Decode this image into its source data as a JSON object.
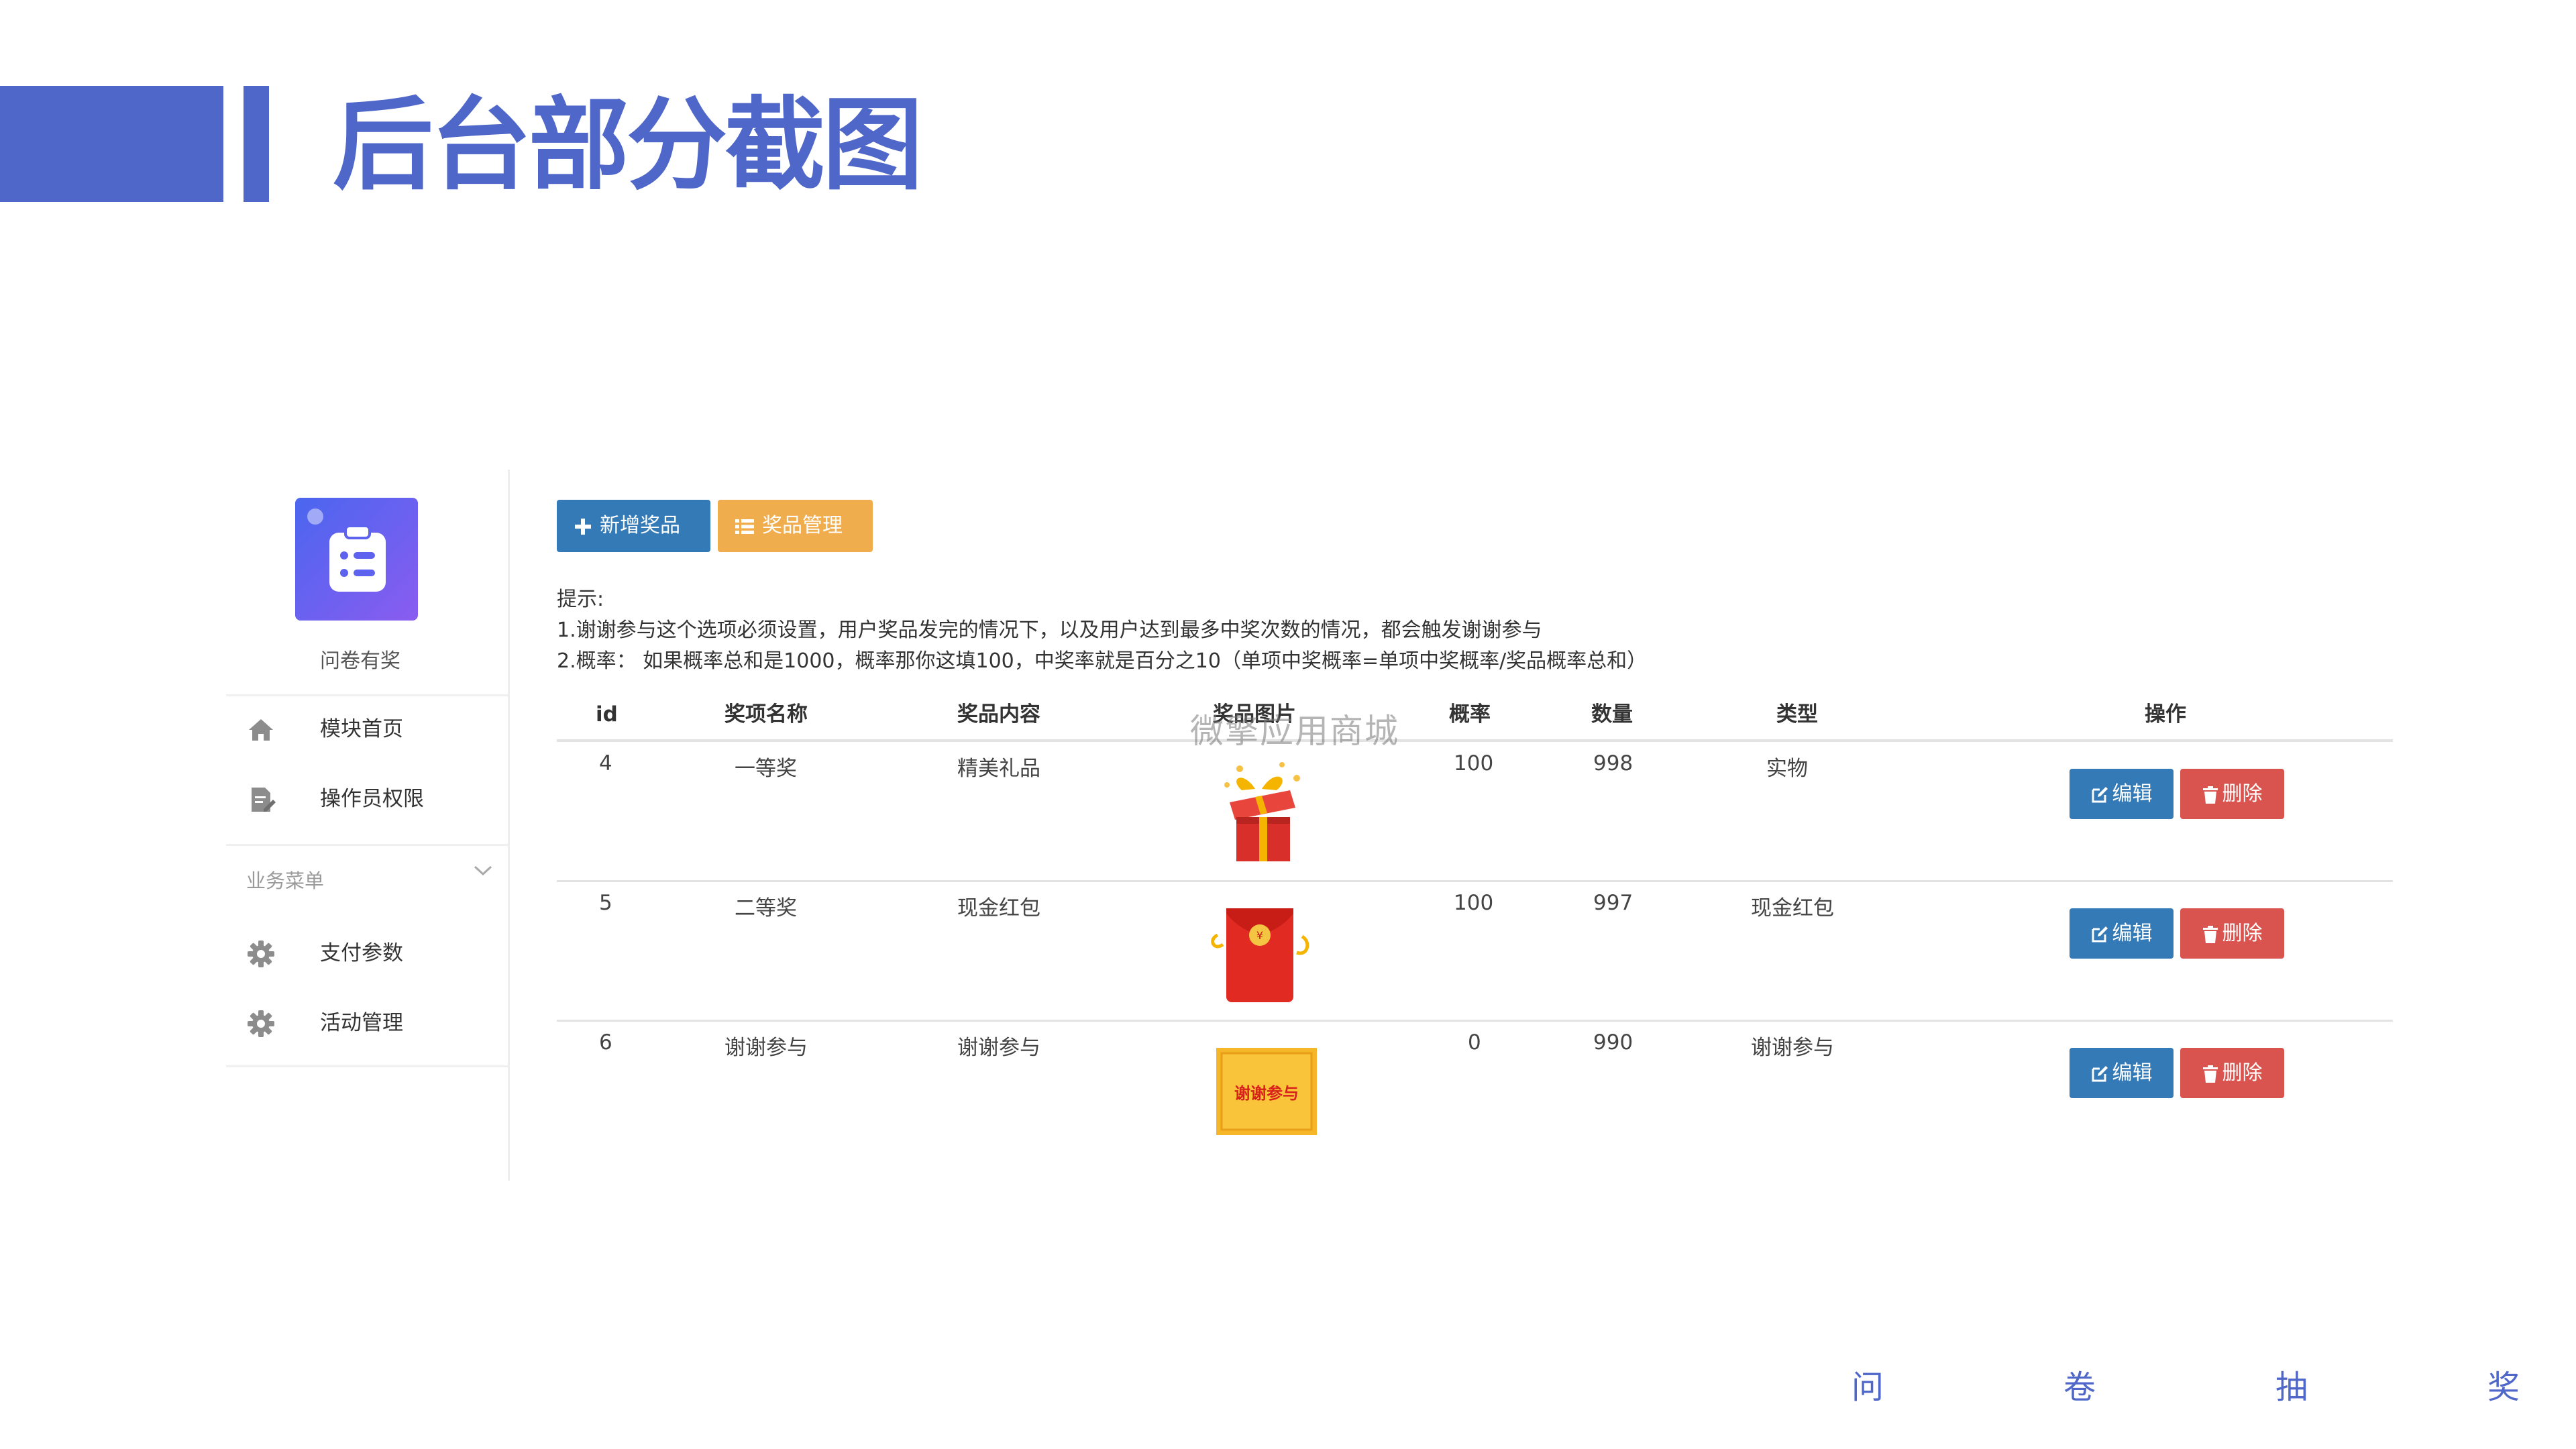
{
  "slide": {
    "title": "后台部分截图",
    "footer": [
      "问",
      "卷",
      "抽",
      "奖"
    ],
    "accent": "#4f67c9"
  },
  "sidebar": {
    "app_name": "问卷有奖",
    "items": [
      {
        "label": "模块首页",
        "icon": "home-icon"
      },
      {
        "label": "操作员权限",
        "icon": "document-edit-icon"
      }
    ],
    "group_label": "业务菜单",
    "group_items": [
      {
        "label": "支付参数",
        "icon": "gear-icon"
      },
      {
        "label": "活动管理",
        "icon": "gear-icon"
      }
    ]
  },
  "toolbar": {
    "add_label": "新增奖品",
    "manage_label": "奖品管理"
  },
  "tips": {
    "heading": "提示:",
    "line1": "1.谢谢参与这个选项必须设置，用户奖品发完的情况下，以及用户达到最多中奖次数的情况，都会触发谢谢参与",
    "line2": "2.概率：  如果概率总和是1000，概率那你这填100，中奖率就是百分之10（单项中奖概率=单项中奖概率/奖品概率总和）"
  },
  "table": {
    "headers": [
      "id",
      "奖项名称",
      "奖品内容",
      "奖品图片",
      "概率",
      "数量",
      "类型",
      "操作"
    ],
    "rows": [
      {
        "id": "4",
        "name": "一等奖",
        "content": "精美礼品",
        "image": "gift-box",
        "prob": "100",
        "qty": "998",
        "type": "实物"
      },
      {
        "id": "5",
        "name": "二等奖",
        "content": "现金红包",
        "image": "red-envelope",
        "prob": "100",
        "qty": "997",
        "type": "现金红包"
      },
      {
        "id": "6",
        "name": "谢谢参与",
        "content": "谢谢参与",
        "image": "thanks-card",
        "image_text": "谢谢参与",
        "prob": "0",
        "qty": "990",
        "type": "谢谢参与"
      }
    ],
    "edit_label": "编辑",
    "delete_label": "删除"
  },
  "watermark": "微擎应用商城"
}
